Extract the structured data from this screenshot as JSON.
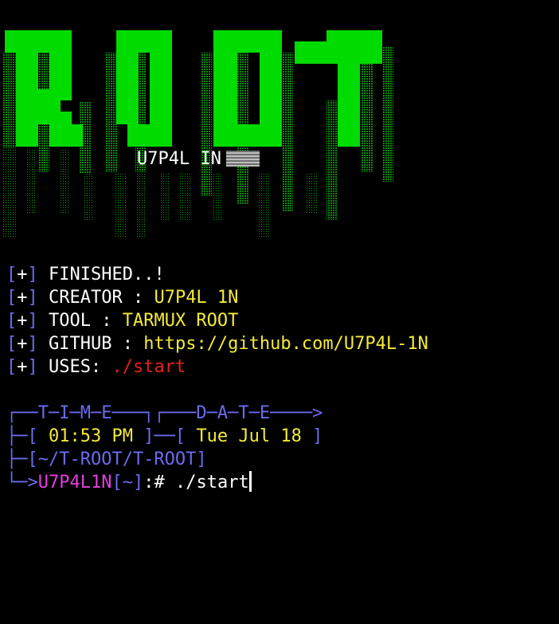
{
  "banner": {
    "logo_text": "ROOT",
    "subtitle": "U7P4L IN"
  },
  "info": [
    {
      "bracket": "[+]",
      "label": "FINISHED..!",
      "value": ""
    },
    {
      "bracket": "[+]",
      "label": "CREATOR : ",
      "value": "U7P4L 1N"
    },
    {
      "bracket": "[+]",
      "label": "TOOL : ",
      "value": "TARMUX ROOT"
    },
    {
      "bracket": "[+]",
      "label": "GITHUB : ",
      "value": "https://github.com/U7P4L-1N"
    },
    {
      "bracket": "[+]",
      "label": "USES: ",
      "value": "./start"
    }
  ],
  "prompt": {
    "header_line": "┌──T─I─M─E───┐┌───D─A─T─E────>",
    "time_prefix": "├─[ ",
    "time": "01:53 PM",
    "mid": " ]──[ ",
    "date": "Tue Jul 18",
    "date_suffix": " ]",
    "path": "├─[~/T-ROOT/T-ROOT]",
    "arrow": "└─>",
    "user": "U7P4L1N",
    "dir": "[~]",
    "symbol": ":# ",
    "command": "./start"
  },
  "colors": {
    "background": "#000000",
    "banner_green": "#00dc00",
    "bracket_blue": "#6b6bf0",
    "value_yellow": "#f4ea3a",
    "uses_red": "#e2221c",
    "user_magenta": "#e23fe0"
  }
}
